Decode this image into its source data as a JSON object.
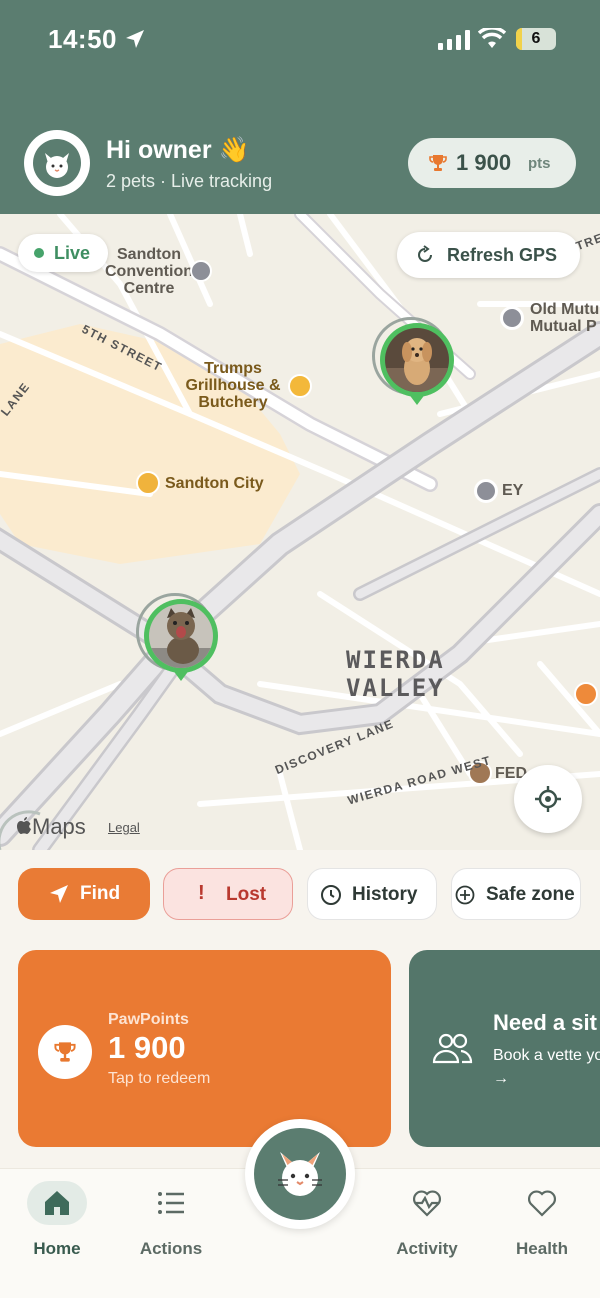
{
  "status_bar": {
    "time": "14:50",
    "battery": "6"
  },
  "header": {
    "greeting": "Hi owner 👋",
    "subtitle": "2 pets · Live tracking",
    "points_value": "1 900",
    "points_unit": "pts"
  },
  "map": {
    "live_label": "Live",
    "refresh_label": "Refresh GPS",
    "labels": {
      "sandton_convention": "Sandton\nConvention\nCentre",
      "trumps": "Trumps\nGrillhouse &\nButchery",
      "sandton_city": "Sandton City",
      "old_mutual": "Old Mutu\nMutual P",
      "ey": "EY",
      "wierda_valley": "WIERDA\nVALLEY",
      "fed": "FED",
      "fifth_street": "5TH STREET",
      "lane": "LANE",
      "discovery_lane": "DISCOVERY LANE",
      "wierda_road_west": "WIERDA ROAD WEST",
      "tre": "TRE"
    },
    "maps_brand": "Maps",
    "legal": "Legal"
  },
  "actions": {
    "find": "Find",
    "lost": "Lost",
    "history": "History",
    "safe_zone": "Safe zone"
  },
  "cards": {
    "points_label": "PawPoints",
    "points_value": "1 900",
    "points_sub": "Tap to redeem",
    "sitter_title": "Need a sit",
    "sitter_sub": "Book a vette you →"
  },
  "nav": {
    "home": "Home",
    "actions": "Actions",
    "activity": "Activity",
    "health": "Health"
  },
  "colors": {
    "header_green": "#5b7d70",
    "accent_orange": "#ea7a33",
    "live_green": "#46a36b",
    "pin_green": "#4fbf60",
    "lost_red": "#b9392f"
  }
}
